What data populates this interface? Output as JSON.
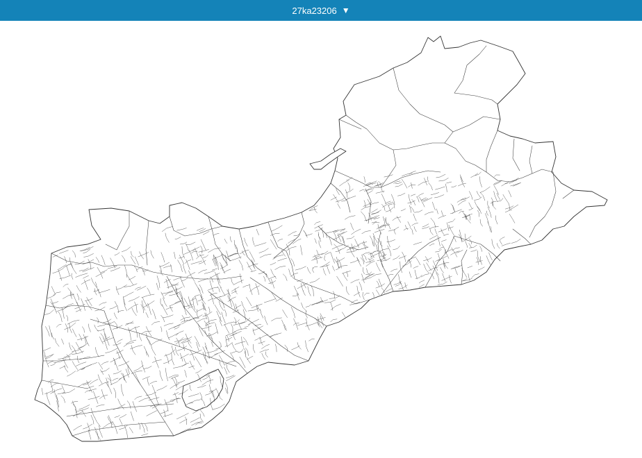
{
  "header": {
    "title": "27ka23206",
    "dropdown_glyph": "▼",
    "background_color": "#1483b8",
    "text_color": "#ffffff"
  },
  "map": {
    "stroke_color": "#333333",
    "fill_color": "#ffffff"
  }
}
